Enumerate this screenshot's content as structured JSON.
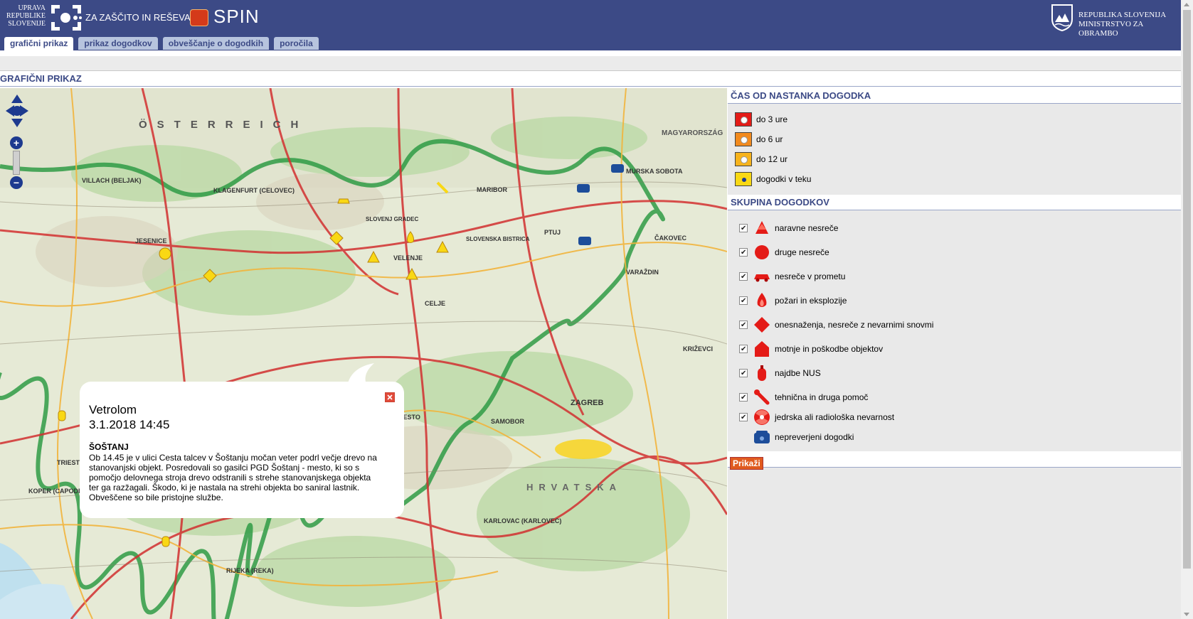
{
  "header": {
    "left_logo": [
      "UPRAVA",
      "REPUBLIKE",
      "SLOVENIJE"
    ],
    "zascita": "ZA ZAŠČITO IN REŠEVANJE",
    "brand": "SPIN",
    "right_logo": [
      "REPUBLIKA SLOVENIJA",
      "MINISTRSTVO ZA OBRAMBO"
    ],
    "tabs": [
      {
        "label": "grafični prikaz",
        "active": true
      },
      {
        "label": "prikaz dogodkov",
        "active": false
      },
      {
        "label": "obveščanje o dogodkih",
        "active": false
      },
      {
        "label": "poročila",
        "active": false
      }
    ],
    "colors": {
      "bar": "#3c4a86",
      "tab_inactive": "#b7c4de"
    }
  },
  "page_title": "GRAFIČNI PRIKAZ",
  "map": {
    "labels": [
      "ÖSTERREICH",
      "MAGYARORSZÁG",
      "KLAGENFURT (CELOVEC)",
      "VILLACH (BELJAK)",
      "JESENICE",
      "CELJE",
      "VELENJE",
      "MARIBOR",
      "PTUJ",
      "MURSKA SOBOTA",
      "ZAGREB",
      "TRIESTE (TRST)",
      "KOPER (CAPODISTRIA)",
      "RIJEKA (REKA)",
      "KARLOVAC (KARLOVEC)",
      "SAMOBOR",
      "NOVO MESTO",
      "HRVATSKA",
      "VARAŽDIN",
      "ČAKOVEC",
      "KRIŽEVCI",
      "SLOVENSKA BISTRICA",
      "SLOVENJ GRADEC"
    ],
    "controls": {
      "pan": "pan-arrows-icon",
      "zoom_in": "+",
      "zoom_out": "−"
    }
  },
  "popup": {
    "title": "Vetrolom",
    "datetime": "3.1.2018 14:45",
    "place": "ŠOŠTANJ",
    "text": "Ob 14.45 je v ulici Cesta talcev v Šoštanju močan veter podrl večje drevo na stanovanjski objekt. Posredovali so gasilci PGD Šoštanj - mesto, ki so s pomočjo delovnega stroja drevo odstranili s strehe stanovanjskega objekta ter ga razžagali. Škodo, ki je nastala na strehi objekta bo saniral lastnik. Obveščene so bile pristojne službe."
  },
  "legend_time": {
    "heading": "ČAS OD NASTANKA DOGODKA",
    "items": [
      {
        "label": "do 3 ure",
        "color": "#e41b17"
      },
      {
        "label": "do 6 ur",
        "color": "#f28a1e"
      },
      {
        "label": "do 12 ur",
        "color": "#f7b31c"
      },
      {
        "label": "dogodki v teku",
        "color": "#f9d814"
      }
    ]
  },
  "legend_groups": {
    "heading": "SKUPINA DOGODKOV",
    "items": [
      {
        "label": "naravne nesreče",
        "icon": "tree-icon",
        "checked": true
      },
      {
        "label": "druge nesreče",
        "icon": "circle-icon",
        "checked": true
      },
      {
        "label": "nesreče v prometu",
        "icon": "car-icon",
        "checked": true
      },
      {
        "label": "požari in eksplozije",
        "icon": "flame-icon",
        "checked": true
      },
      {
        "label": "onesnaženja, nesreče z nevarnimi snovmi",
        "icon": "diamond-icon",
        "checked": true
      },
      {
        "label": "motnje in poškodbe objektov",
        "icon": "house-icon",
        "checked": true
      },
      {
        "label": "najdbe NUS",
        "icon": "bomb-icon",
        "checked": true
      },
      {
        "label": "tehnična in druga pomoč",
        "icon": "wrench-icon",
        "checked": true
      },
      {
        "label": "jedrska ali radiološka nevarnost",
        "icon": "radiation-icon",
        "checked": true
      },
      {
        "label": "nepreverjeni dogodki",
        "icon": "phone-icon",
        "checked": false
      }
    ],
    "button": "Prikaži"
  }
}
